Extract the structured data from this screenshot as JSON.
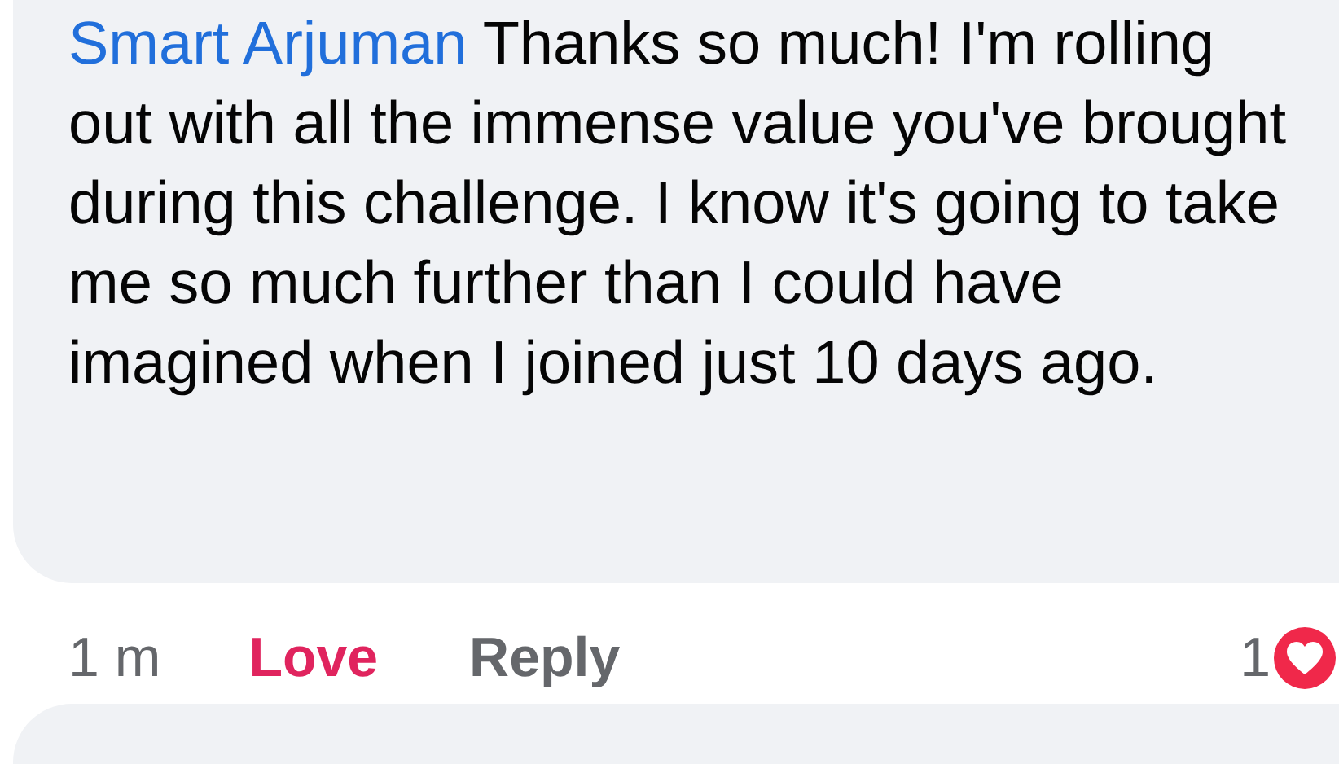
{
  "comment": {
    "author": "Smart Arjuman",
    "text": "Thanks so much! I'm rolling out with all the immense value you've brought during this challenge. I know it's going to take me so much further than I could have imagined when I joined just 10 days ago."
  },
  "actions": {
    "time": "1 m",
    "reaction": {
      "label": "Love",
      "selected": true
    },
    "reply": "Reply",
    "reaction_count": "1"
  }
}
